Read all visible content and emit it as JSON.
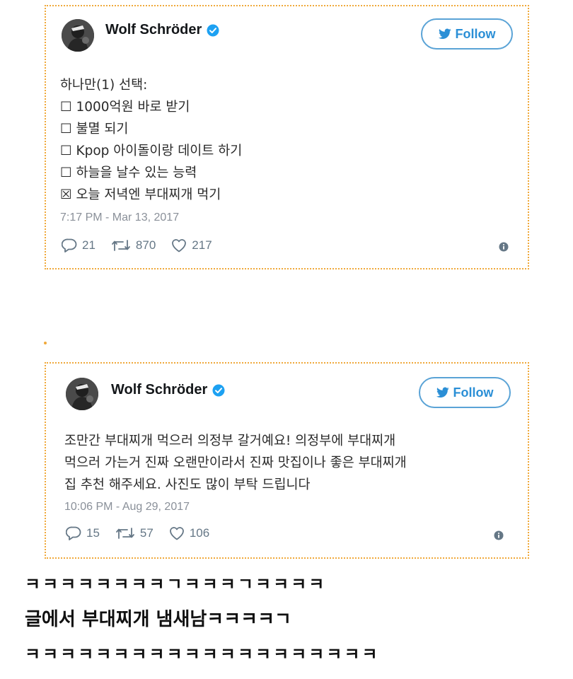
{
  "tweets": [
    {
      "user_name": "Wolf Schröder",
      "follow_label": "Follow",
      "lines": [
        "하나만(1) 선택:",
        "☐ 1000억원 바로 받기",
        "☐ 불멸 되기",
        "☐ Kpop 아이돌이랑 데이트 하기",
        "☐ 하늘을 날수 있는 능력",
        "☒ 오늘 저녁엔 부대찌개 먹기"
      ],
      "timestamp": "7:17 PM - Mar 13, 2017",
      "replies": "21",
      "retweets": "870",
      "likes": "217"
    },
    {
      "user_name": "Wolf Schröder",
      "follow_label": "Follow",
      "lines": [
        "조만간 부대찌개 먹으러 의정부 갈거예요! 의정부에 부대찌개",
        "먹으러 가는거 진짜 오랜만이라서 진짜 맛집이나 좋은 부대찌개",
        "집 추천 해주세요. 사진도 많이 부탁 드립니다"
      ],
      "timestamp": "10:06 PM - Aug 29, 2017",
      "replies": "15",
      "retweets": "57",
      "likes": "106"
    }
  ],
  "comments": [
    "ㅋㅋㅋㅋㅋㅋㅋㅋㄱㅋㅋㅋㄱㅋㅋㅋㅋ",
    "글에서 부대찌개 냄새남ㅋㅋㅋㅋㄱ",
    "ㅋㅋㅋㅋㅋㅋㅋㅋㅋㅋㅋㅋㅋㅋㅋㅋㅋㅋㅋㅋ"
  ],
  "colors": {
    "card_border": "#f0a93b",
    "twitter_blue": "#1da1f2",
    "muted_text": "#8a9099",
    "icon_gray": "#657786"
  },
  "icons": {
    "verified": "verified-badge-icon",
    "follow": "twitter-bird-icon",
    "reply": "speech-bubble-icon",
    "retweet": "retweet-arrows-icon",
    "like": "heart-icon",
    "info": "info-circle-icon"
  }
}
